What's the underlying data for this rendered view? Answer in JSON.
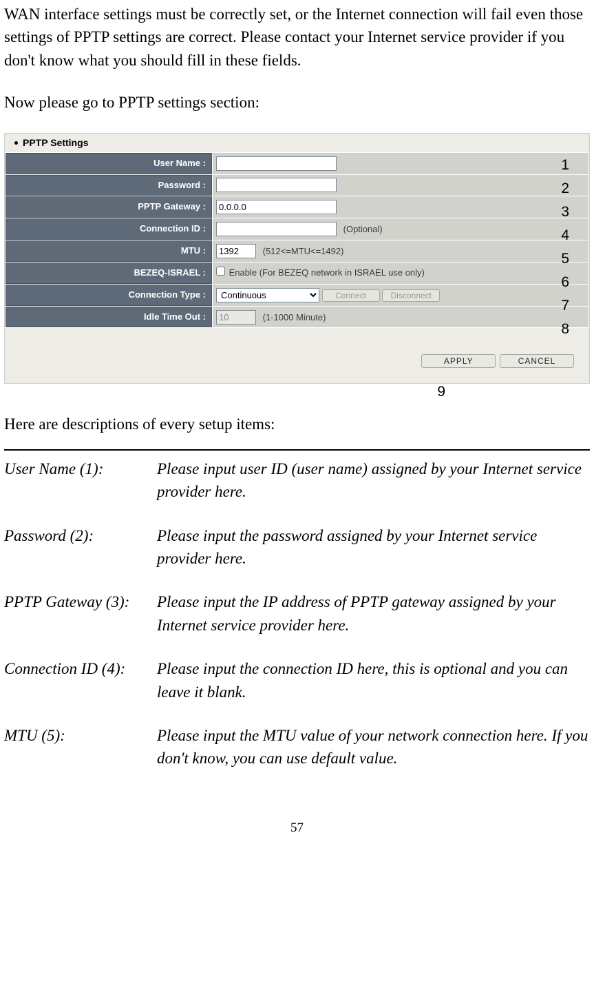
{
  "intro": {
    "p1": "WAN interface settings must be correctly set, or the Internet connection will fail even those settings of PPTP settings are correct. Please contact your Internet service provider if you don't know what you should fill in these fields.",
    "p2": "Now please go to PPTP settings section:"
  },
  "panel": {
    "title": "PPTP Settings",
    "rows": {
      "username": {
        "label": "User Name :",
        "value": ""
      },
      "password": {
        "label": "Password :",
        "value": ""
      },
      "gateway": {
        "label": "PPTP Gateway :",
        "value": "0.0.0.0"
      },
      "connid": {
        "label": "Connection ID :",
        "value": "",
        "note": "(Optional)"
      },
      "mtu": {
        "label": "MTU :",
        "value": "1392",
        "note": "(512<=MTU<=1492)"
      },
      "bezeq": {
        "label": "BEZEQ-ISRAEL :",
        "check_label": "Enable (For BEZEQ network in ISRAEL use only)"
      },
      "conntype": {
        "label": "Connection Type :",
        "selected": "Continuous",
        "btn_connect": "Connect",
        "btn_disconnect": "Disconnect"
      },
      "idle": {
        "label": "Idle Time Out :",
        "value": "10",
        "note": "(1-1000 Minute)"
      }
    },
    "buttons": {
      "apply": "APPLY",
      "cancel": "CANCEL"
    },
    "callouts": [
      "1",
      "2",
      "3",
      "4",
      "5",
      "6",
      "7",
      "8",
      "9"
    ]
  },
  "desc": {
    "intro": "Here are descriptions of every setup items:",
    "items": [
      {
        "term": "User Name (1):",
        "def": "Please input user ID (user name) assigned by your Internet service provider here."
      },
      {
        "term": "Password (2):",
        "def": "Please input the password assigned by your Internet service provider here."
      },
      {
        "term": "PPTP Gateway (3):",
        "def": "Please input the IP address of PPTP gateway assigned by your Internet service provider here."
      },
      {
        "term": "Connection ID (4):",
        "def": "Please input the connection ID here, this is optional and you can leave it blank."
      },
      {
        "term": "MTU (5):",
        "def": "Please input the MTU value of your network connection here. If you don't know, you can use default value."
      }
    ]
  },
  "page_number": "57"
}
